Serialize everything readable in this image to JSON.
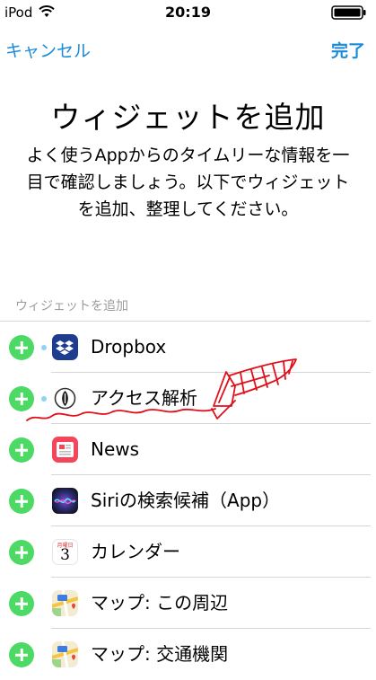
{
  "status_bar": {
    "carrier": "iPod",
    "time": "20:19"
  },
  "nav": {
    "cancel": "キャンセル",
    "done": "完了"
  },
  "title": "ウィジェットを追加",
  "description": "よく使うAppからのタイムリーな情報を一目で確認しましょう。以下でウィジェットを追加、整理してください。",
  "section_header": "ウィジェットを追加",
  "widgets": [
    {
      "label": "Dropbox",
      "icon": "dropbox-icon",
      "dot": true
    },
    {
      "label": "アクセス解析",
      "icon": "access-analytics-icon",
      "dot": true
    },
    {
      "label": "News",
      "icon": "news-icon",
      "dot": false
    },
    {
      "label": "Siriの検索候補（App）",
      "icon": "siri-icon",
      "dot": false
    },
    {
      "label": "カレンダー",
      "icon": "calendar-icon",
      "dot": false,
      "calendar_weekday": "月曜日",
      "calendar_day": "3"
    },
    {
      "label": "マップ: この周辺",
      "icon": "maps-icon",
      "dot": false
    },
    {
      "label": "マップ: 交通機関",
      "icon": "maps-icon",
      "dot": false
    }
  ],
  "colors": {
    "accent": "#1b8cd9",
    "add_button": "#4cd964",
    "annotation": "#e0101a"
  }
}
